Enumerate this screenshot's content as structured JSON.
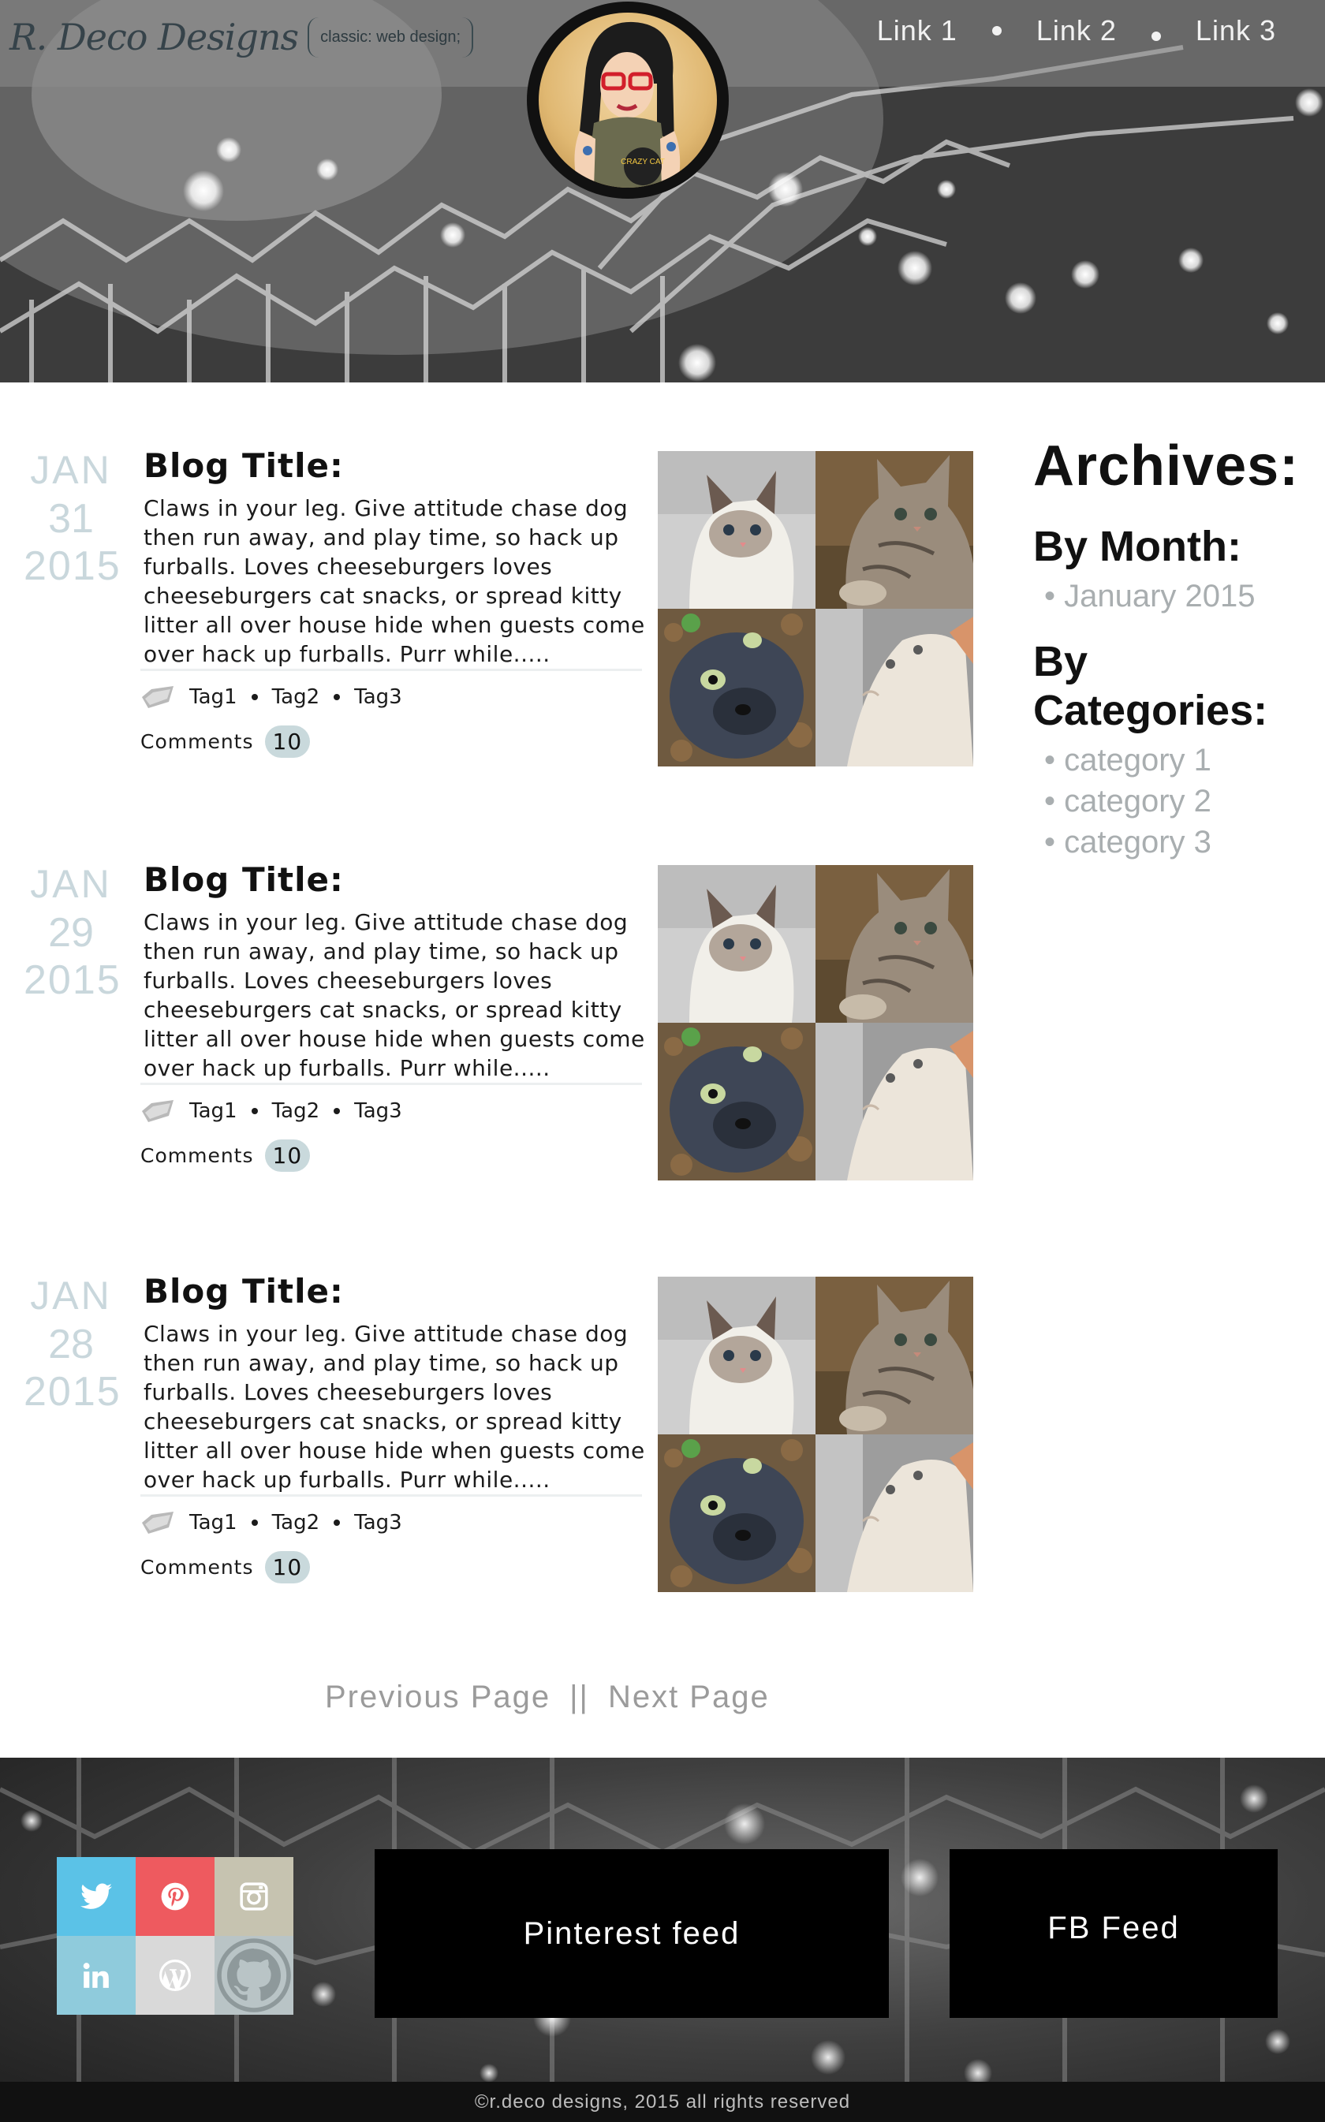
{
  "brand": {
    "logo_text": "R. Deco Designs",
    "tagline": "classic: web design;"
  },
  "avatar": {
    "badge_text": "CRAZY CAT"
  },
  "nav": {
    "links": [
      "Link 1",
      "Link 2",
      "Link 3"
    ]
  },
  "posts": [
    {
      "month": "JAN",
      "day": "31",
      "year": "2015",
      "title": "Blog Title:",
      "excerpt": "Claws in your leg. Give attitude chase dog then run away, and play time, so hack up furballs. Loves cheeseburgers loves cheeseburgers cat snacks, or spread kitty litter all over house hide when guests come over hack up furballs. Purr while.....",
      "tags": [
        "Tag1",
        "Tag2",
        "Tag3"
      ],
      "comments_label": "Comments",
      "comments_count": "10"
    },
    {
      "month": "JAN",
      "day": "29",
      "year": "2015",
      "title": "Blog Title:",
      "excerpt": "Claws in your leg. Give attitude chase dog then run away, and play time, so hack up furballs. Loves cheeseburgers loves cheeseburgers cat snacks, or spread kitty litter all over house hide when guests come over hack up furballs. Purr while.....",
      "tags": [
        "Tag1",
        "Tag2",
        "Tag3"
      ],
      "comments_label": "Comments",
      "comments_count": "10"
    },
    {
      "month": "JAN",
      "day": "28",
      "year": "2015",
      "title": "Blog Title:",
      "excerpt": "Claws in your leg. Give attitude chase dog then run away, and play time, so hack up furballs. Loves cheeseburgers loves cheeseburgers cat snacks, or spread kitty litter all over house hide when guests come over hack up furballs. Purr while.....",
      "tags": [
        "Tag1",
        "Tag2",
        "Tag3"
      ],
      "comments_label": "Comments",
      "comments_count": "10"
    }
  ],
  "sidebar": {
    "title": "Archives:",
    "by_month_heading": "By Month:",
    "months": [
      "January 2015"
    ],
    "by_categories_heading": "By Categories:",
    "categories": [
      "category 1",
      "category 2",
      "category 3"
    ]
  },
  "pager": {
    "previous": "Previous Page",
    "separator": "||",
    "next": "Next Page"
  },
  "footer": {
    "social": [
      {
        "icon": "twitter-icon",
        "color": "#5bc2e7"
      },
      {
        "icon": "pinterest-icon",
        "color": "#ee5a5f"
      },
      {
        "icon": "instagram-icon",
        "color": "#c6c3b0"
      },
      {
        "icon": "linkedin-icon",
        "color": "#8fcbdc"
      },
      {
        "icon": "wordpress-icon",
        "color": "#d9d9d9"
      },
      {
        "icon": "github-icon",
        "color": "#b9c4c6"
      }
    ],
    "pinterest_feed": "Pinterest feed",
    "fb_feed": "FB Feed",
    "copyright": "©r.deco designs, 2015 all rights reserved"
  },
  "colors": {
    "date": "#c9d7dc",
    "count_badge": "#c9d9dc",
    "sidebar_link": "#a9aeb0",
    "pager": "#9b9b9b"
  }
}
